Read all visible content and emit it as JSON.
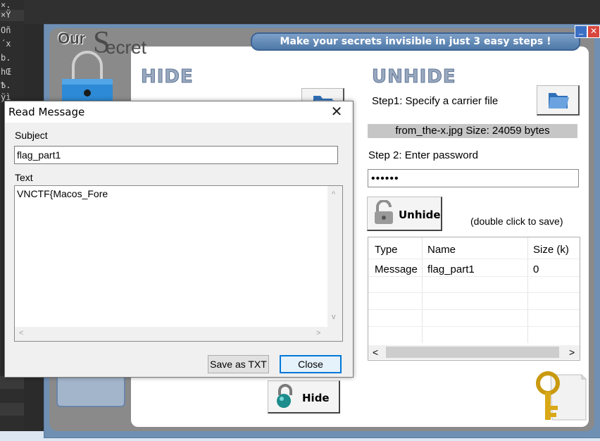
{
  "terminal": {
    "lines": [
      "×.",
      "×Ÿ",
      "Oñ",
      "´x",
      "b.",
      "hŒ",
      "Ѣ.",
      "ÿì"
    ]
  },
  "app": {
    "logo_our": "Our",
    "logo_s": "S",
    "logo_rest": "ecret",
    "banner": "Make your secrets invisible in just 3 easy steps !",
    "min_label": "_",
    "close_label": "✕"
  },
  "hide_section": {
    "heading": "HIDE",
    "hide_button": "Hide"
  },
  "unhide_section": {
    "heading": "UNHIDE",
    "step1": "Step1: Specify a carrier file",
    "file_info": "from_the-x.jpg  Size: 24059 bytes",
    "step2": "Step 2: Enter password",
    "password_mask": "••••••",
    "unhide_button": "Unhide",
    "double_click_hint": "(double click to save)"
  },
  "list": {
    "headers": [
      "Type",
      "Name",
      "Size (k)"
    ],
    "rows": [
      {
        "type": "Message",
        "name": "flag_part1",
        "size": "0"
      }
    ],
    "scroll_left": "<",
    "scroll_right": ">"
  },
  "dialog": {
    "title": "Read Message",
    "close_glyph": "✕",
    "subject_label": "Subject",
    "subject_value": "flag_part1",
    "text_label": "Text",
    "text_value": "VNCTF{Macos_Fore",
    "save_button": "Save as TXT",
    "close_button": "Close",
    "arrow_up": "^",
    "arrow_down": "v",
    "arrow_left": "<",
    "arrow_right": ">"
  }
}
